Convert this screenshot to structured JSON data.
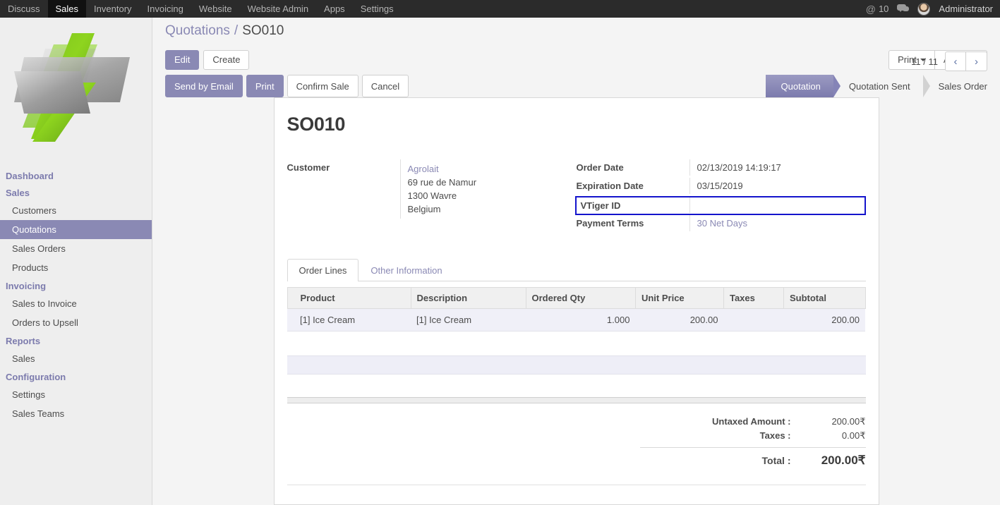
{
  "navbar": {
    "items": [
      {
        "label": "Discuss",
        "active": false
      },
      {
        "label": "Sales",
        "active": true
      },
      {
        "label": "Inventory",
        "active": false
      },
      {
        "label": "Invoicing",
        "active": false
      },
      {
        "label": "Website",
        "active": false
      },
      {
        "label": "Website Admin",
        "active": false
      },
      {
        "label": "Apps",
        "active": false
      },
      {
        "label": "Settings",
        "active": false
      }
    ],
    "mention_icon": "at-sign-icon",
    "mention_count": "10",
    "messages_icon": "chat-bubble-icon",
    "avatar_icon": "user-avatar",
    "user_name": "Administrator"
  },
  "sidebar": {
    "logo_icon": "company-logo",
    "groups": [
      {
        "title": "Dashboard",
        "items": []
      },
      {
        "title": "Sales",
        "items": [
          {
            "label": "Customers",
            "active": false
          },
          {
            "label": "Quotations",
            "active": true
          },
          {
            "label": "Sales Orders",
            "active": false
          },
          {
            "label": "Products",
            "active": false
          }
        ]
      },
      {
        "title": "Invoicing",
        "items": [
          {
            "label": "Sales to Invoice",
            "active": false
          },
          {
            "label": "Orders to Upsell",
            "active": false
          }
        ]
      },
      {
        "title": "Reports",
        "items": [
          {
            "label": "Sales",
            "active": false
          }
        ]
      },
      {
        "title": "Configuration",
        "items": [
          {
            "label": "Settings",
            "active": false
          },
          {
            "label": "Sales Teams",
            "active": false
          }
        ]
      }
    ]
  },
  "breadcrumb": {
    "parent": "Quotations",
    "separator": "/",
    "current": "SO010"
  },
  "control_bar": {
    "edit_label": "Edit",
    "create_label": "Create",
    "print_label": "Print",
    "action_label": "Action",
    "pager_text": "11 / 11",
    "prev_icon": "chevron-left-icon",
    "next_icon": "chevron-right-icon"
  },
  "status_bar": {
    "buttons": [
      {
        "label": "Send by Email",
        "primary": true
      },
      {
        "label": "Print",
        "primary": true
      },
      {
        "label": "Confirm Sale",
        "primary": false
      },
      {
        "label": "Cancel",
        "primary": false
      }
    ],
    "stages": [
      {
        "label": "Quotation",
        "active": true
      },
      {
        "label": "Quotation Sent",
        "active": false
      },
      {
        "label": "Sales Order",
        "active": false
      }
    ]
  },
  "form": {
    "title": "SO010",
    "left": {
      "customer_label": "Customer",
      "customer_name": "Agrolait",
      "address": [
        "69 rue de Namur",
        "1300 Wavre",
        "Belgium"
      ]
    },
    "right": {
      "order_date_label": "Order Date",
      "order_date_value": "02/13/2019 14:19:17",
      "expiration_date_label": "Expiration Date",
      "expiration_date_value": "03/15/2019",
      "vtiger_id_label": "VTiger ID",
      "vtiger_id_value": "",
      "payment_terms_label": "Payment Terms",
      "payment_terms_value": "30 Net Days"
    }
  },
  "notebook": {
    "tabs": [
      {
        "label": "Order Lines",
        "active": true
      },
      {
        "label": "Other Information",
        "active": false
      }
    ]
  },
  "order_lines": {
    "columns": [
      "Product",
      "Description",
      "Ordered Qty",
      "Unit Price",
      "Taxes",
      "Subtotal"
    ],
    "rows": [
      {
        "product": "[1] Ice Cream",
        "description": "[1] Ice Cream",
        "ordered_qty": "1.000",
        "unit_price": "200.00",
        "taxes": "",
        "subtotal": "200.00"
      }
    ]
  },
  "totals": {
    "untaxed_label": "Untaxed Amount :",
    "untaxed_value": "200.00₹",
    "taxes_label": "Taxes :",
    "taxes_value": "0.00₹",
    "total_label": "Total :",
    "total_value": "200.00₹"
  },
  "colors": {
    "accent": "#8a89b4",
    "navbar_bg": "#2b2b2b",
    "sidebar_bg": "#eeeeee",
    "highlight_border": "#1414cc",
    "row_bg": "#f0f0f8"
  }
}
